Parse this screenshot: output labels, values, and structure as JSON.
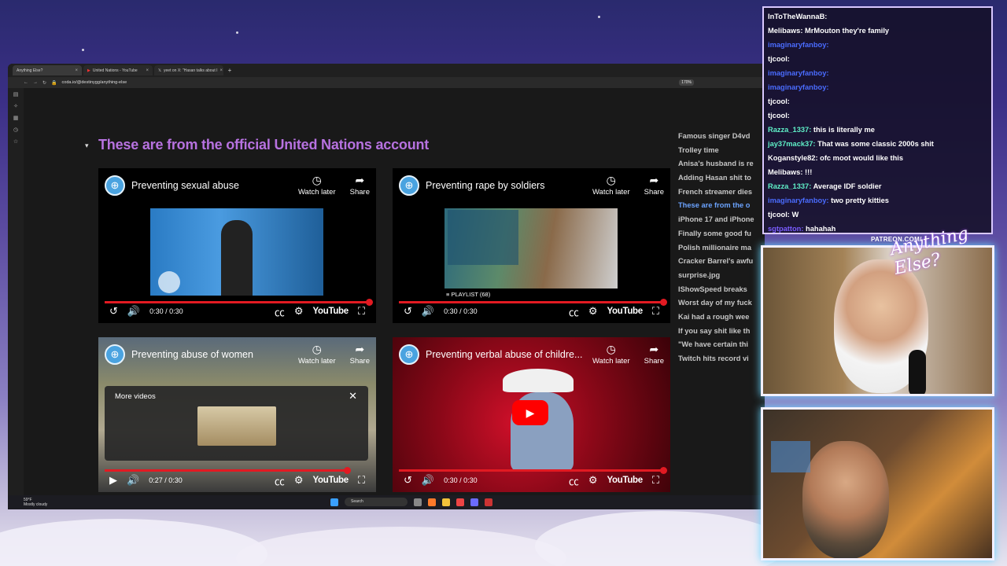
{
  "browser": {
    "tabs": [
      {
        "label": "Anything Else?",
        "active": true
      },
      {
        "label": "United Nations - YouTube",
        "active": false
      },
      {
        "label": "yeet on X: \"Hasan talks about I",
        "active": false
      }
    ],
    "url": "coda.io/@destinygg/anything-else",
    "zoom": "170%"
  },
  "doc": {
    "title": "These are from the official United Nations account"
  },
  "videos": [
    {
      "title": "Preventing sexual abuse",
      "time": "0:30 / 0:30",
      "watch_later": "Watch later",
      "share": "Share",
      "brand": "YouTube"
    },
    {
      "title": "Preventing rape by soldiers",
      "time": "0:30 / 0:30",
      "watch_later": "Watch later",
      "share": "Share",
      "brand": "YouTube",
      "playlist": "PLAYLIST (68)"
    },
    {
      "title": "Preventing abuse of women",
      "time": "0:27 / 0:30",
      "watch_later": "Watch later",
      "share": "Share",
      "brand": "YouTube",
      "more_videos": "More videos"
    },
    {
      "title": "Preventing verbal abuse of childre...",
      "time": "0:30 / 0:30",
      "watch_later": "Watch later",
      "share": "Share",
      "brand": "YouTube"
    }
  ],
  "right_list": [
    "Famous singer D4vd",
    "Trolley time",
    "Anisa's husband is re",
    "Adding Hasan shit to",
    "French streamer dies",
    "These are from the o",
    "iPhone 17 and iPhone",
    "Finally some good fu",
    "Polish millionaire ma",
    "Cracker Barrel's awfu",
    "surprise.jpg",
    "IShowSpeed breaks",
    "Worst day of my fuck",
    "Kai had a rough wee",
    "If you say shit like th",
    "\"We have certain thi",
    "Twitch hits record vi"
  ],
  "right_list_active_index": 5,
  "taskbar": {
    "weather_temp": "59°F",
    "weather_desc": "Mostly cloudy",
    "search": "Search"
  },
  "chat": [
    {
      "user": "InToTheWannaB:",
      "text": "",
      "color": "#ffffff"
    },
    {
      "user": "Melibaws:",
      "text": "MrMouton they're family",
      "color": "#ffffff"
    },
    {
      "user": "imaginaryfanboy:",
      "text": "",
      "color": "#4a6cff"
    },
    {
      "user": "tjcool:",
      "text": "",
      "color": "#ffffff"
    },
    {
      "user": "imaginaryfanboy:",
      "text": "",
      "color": "#4a6cff"
    },
    {
      "user": "imaginaryfanboy:",
      "text": "",
      "color": "#4a6cff"
    },
    {
      "user": "tjcool:",
      "text": "",
      "color": "#ffffff"
    },
    {
      "user": "tjcool:",
      "text": "",
      "color": "#ffffff"
    },
    {
      "user": "Razza_1337:",
      "text": "this is literally me",
      "color": "#5ff0c8"
    },
    {
      "user": "jay37mack37:",
      "text": "That was some classic 2000s shit",
      "color": "#5ff0c8"
    },
    {
      "user": "Koganstyle82:",
      "text": "ofc moot would like this",
      "color": "#ffffff"
    },
    {
      "user": "Melibaws:",
      "text": "!!!",
      "color": "#ffffff"
    },
    {
      "user": "Razza_1337:",
      "text": "Average IDF soldier",
      "color": "#5ff0c8"
    },
    {
      "user": "imaginaryfanboy:",
      "text": "two pretty kitties",
      "color": "#4a6cff"
    },
    {
      "user": "tjcool:",
      "text": "W",
      "color": "#ffffff"
    },
    {
      "user": "sgtpatton:",
      "text": "hahahah",
      "color": "#7a5cff"
    }
  ],
  "overlay": {
    "patreon": "PATREON.COM/",
    "brand": "Anything Else?"
  }
}
